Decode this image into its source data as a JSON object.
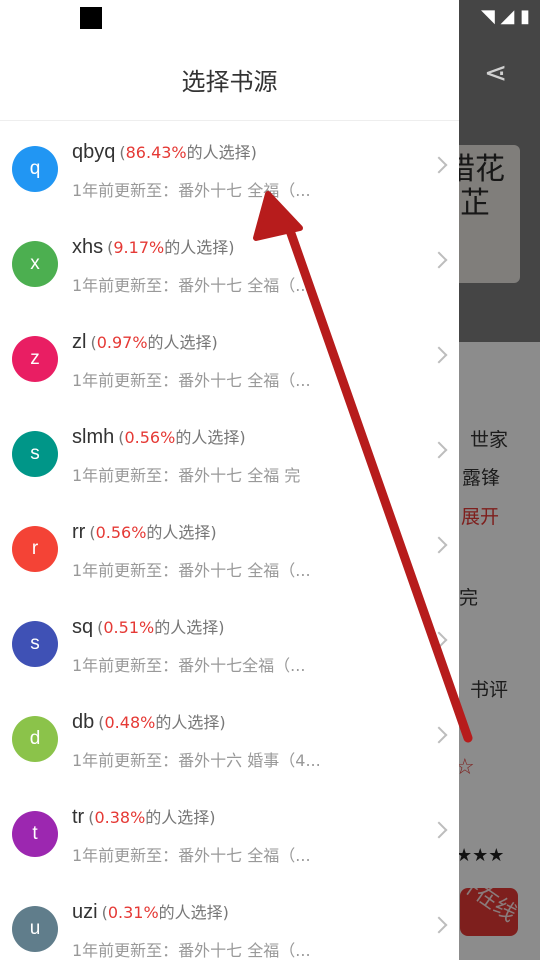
{
  "drawer": {
    "title": "选择书源"
  },
  "sources": [
    {
      "letter": "q",
      "name": "qbyq",
      "pct": "86.43%",
      "suffix": "的人选择)",
      "prefix": "(",
      "update": "1年前更新至：番外十七 全福（...",
      "color": "#2196f3"
    },
    {
      "letter": "x",
      "name": "xhs",
      "pct": "9.17%",
      "suffix": "的人选择)",
      "prefix": "(",
      "update": "1年前更新至：番外十七 全福（...",
      "color": "#4caf50"
    },
    {
      "letter": "z",
      "name": "zl",
      "pct": "0.97%",
      "suffix": "的人选择)",
      "prefix": "(",
      "update": "1年前更新至：番外十七 全福（...",
      "color": "#e91e63"
    },
    {
      "letter": "s",
      "name": "slmh",
      "pct": "0.56%",
      "suffix": "的人选择)",
      "prefix": "(",
      "update": "1年前更新至：番外十七 全福 完",
      "color": "#009688"
    },
    {
      "letter": "r",
      "name": "rr",
      "pct": "0.56%",
      "suffix": "的人选择)",
      "prefix": "(",
      "update": "1年前更新至：番外十七 全福（...",
      "color": "#f44336"
    },
    {
      "letter": "s",
      "name": "sq",
      "pct": "0.51%",
      "suffix": "的人选择)",
      "prefix": "(",
      "update": "1年前更新至：番外十七全福（...",
      "color": "#3f51b5"
    },
    {
      "letter": "d",
      "name": "db",
      "pct": "0.48%",
      "suffix": "的人选择)",
      "prefix": "(",
      "update": "1年前更新至：番外十六 婚事（4...",
      "color": "#8bc34a"
    },
    {
      "letter": "t",
      "name": "tr",
      "pct": "0.38%",
      "suffix": "的人选择)",
      "prefix": "(",
      "update": "1年前更新至：番外十七 全福（...",
      "color": "#9c27b0"
    },
    {
      "letter": "u",
      "name": "uzi",
      "pct": "0.31%",
      "suffix": "的人选择)",
      "prefix": "(",
      "update": "1年前更新至：番外十七 全福（...",
      "color": "#607d8b"
    }
  ],
  "background": {
    "text1": "世家",
    "text2": "露锋",
    "expand": "展开",
    "done": "完",
    "review": "书评",
    "watermark": "开在线",
    "cover_text": "惜花芷"
  }
}
